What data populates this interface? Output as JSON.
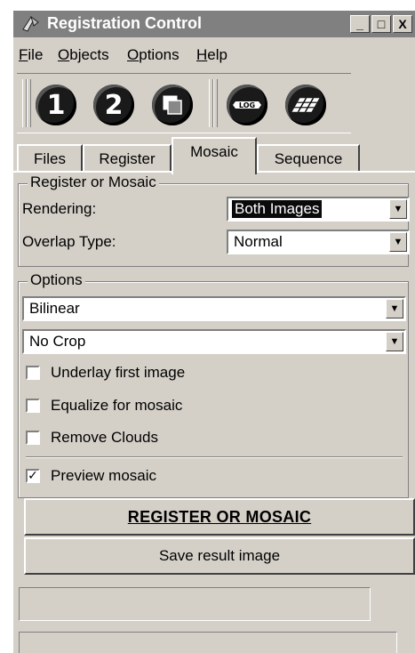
{
  "window": {
    "title": "Registration Control",
    "controls": {
      "minimize": "_",
      "maximize": "□",
      "close": "X"
    }
  },
  "menu": {
    "items": [
      "File",
      "Objects",
      "Options",
      "Help"
    ]
  },
  "toolbar": {
    "buttons": [
      {
        "label": "1",
        "icon": "step-one-icon"
      },
      {
        "label": "2",
        "icon": "step-two-icon"
      },
      {
        "label": "",
        "icon": "overlay-squares-icon"
      },
      {
        "label": "",
        "icon": "log-icon"
      },
      {
        "label": "",
        "icon": "grid-mosaic-icon"
      }
    ]
  },
  "tabs": [
    "Files",
    "Register",
    "Mosaic",
    "Sequence"
  ],
  "active_tab": "Mosaic",
  "register_group": {
    "legend": "Register or Mosaic",
    "rendering_label": "Rendering:",
    "rendering_value": "Both Images",
    "overlap_label": "Overlap Type:",
    "overlap_value": "Normal"
  },
  "options_group": {
    "legend": "Options",
    "interpolation_value": "Bilinear",
    "crop_value": "No Crop",
    "checks": [
      {
        "label": "Underlay first image",
        "checked": false
      },
      {
        "label": "Equalize for mosaic",
        "checked": false
      },
      {
        "label": "Remove Clouds",
        "checked": false
      }
    ],
    "preview": {
      "label": "Preview mosaic",
      "checked": true
    }
  },
  "actions": {
    "primary_label": "REGISTER OR MOSAIC",
    "save_label": "Save result image"
  },
  "colors": {
    "face": "#d4d0c8",
    "title_inactive": "#808080",
    "highlight": "#0a0a0a"
  }
}
